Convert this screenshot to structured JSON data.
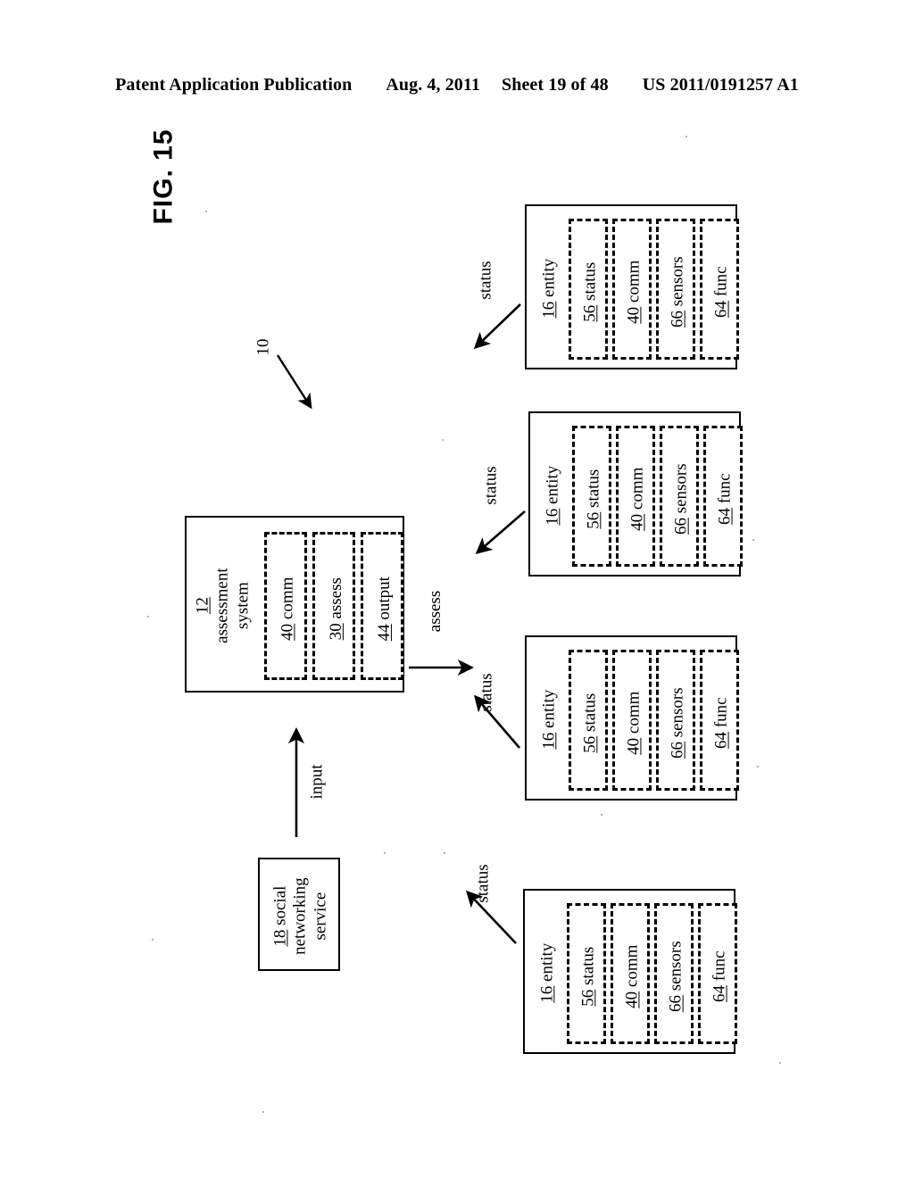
{
  "header": {
    "publication": "Patent Application Publication",
    "date": "Aug. 4, 2011",
    "sheet": "Sheet 19 of 48",
    "patent_number": "US 2011/0191257 A1"
  },
  "figure": {
    "label": "FIG. 15",
    "system_reference": "10"
  },
  "assessment_system": {
    "ref": "12",
    "title": "assessment system",
    "modules": [
      {
        "ref": "40",
        "label": "comm"
      },
      {
        "ref": "30",
        "label": "assess"
      },
      {
        "ref": "44",
        "label": "output"
      }
    ]
  },
  "social_networking_service": {
    "ref": "18",
    "title": "social networking service"
  },
  "flows": {
    "input": "input",
    "assess": "assess",
    "status": "status"
  },
  "entities": [
    {
      "ref": "16",
      "title": "entity",
      "status_flow": "status",
      "modules": [
        {
          "ref": "56",
          "label": "status"
        },
        {
          "ref": "40",
          "label": "comm"
        },
        {
          "ref": "66",
          "label": "sensors"
        },
        {
          "ref": "64",
          "label": "func"
        }
      ]
    },
    {
      "ref": "16",
      "title": "entity",
      "status_flow": "status",
      "modules": [
        {
          "ref": "56",
          "label": "status"
        },
        {
          "ref": "40",
          "label": "comm"
        },
        {
          "ref": "66",
          "label": "sensors"
        },
        {
          "ref": "64",
          "label": "func"
        }
      ]
    },
    {
      "ref": "16",
      "title": "entity",
      "status_flow": "status",
      "modules": [
        {
          "ref": "56",
          "label": "status"
        },
        {
          "ref": "40",
          "label": "comm"
        },
        {
          "ref": "66",
          "label": "sensors"
        },
        {
          "ref": "64",
          "label": "func"
        }
      ]
    },
    {
      "ref": "16",
      "title": "entity",
      "status_flow": "status",
      "modules": [
        {
          "ref": "56",
          "label": "status"
        },
        {
          "ref": "40",
          "label": "comm"
        },
        {
          "ref": "66",
          "label": "sensors"
        },
        {
          "ref": "64",
          "label": "func"
        }
      ]
    }
  ],
  "colors": {
    "ink": "#000000",
    "paper": "#ffffff"
  }
}
